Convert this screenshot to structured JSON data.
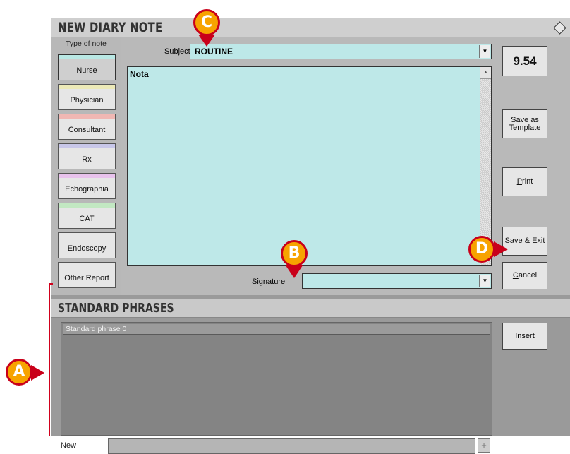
{
  "window": {
    "title": "NEW DIARY NOTE"
  },
  "note_types": {
    "header": "Type of note",
    "items": [
      {
        "label": "Nurse",
        "color": "#b9e8e4"
      },
      {
        "label": "Physician",
        "color": "#ece9b7"
      },
      {
        "label": "Consultant",
        "color": "#f0b7b3"
      },
      {
        "label": "Rx",
        "color": "#c8c7e9"
      },
      {
        "label": "Echographia",
        "color": "#e8c2ec"
      },
      {
        "label": "CAT",
        "color": "#c2e8c2"
      },
      {
        "label": "Endoscopy",
        "color": "#e6e6e6"
      },
      {
        "label": "Other Report",
        "color": "#e6e6e6"
      }
    ]
  },
  "subject": {
    "label": "Subject",
    "value": "ROUTINE"
  },
  "note": {
    "text": "Nota"
  },
  "signature": {
    "label": "Signature",
    "value": ""
  },
  "actions": {
    "clock": "9.54",
    "save_template": "Save as Template",
    "print": "Print",
    "save_exit": "Save & Exit",
    "cancel": "Cancel"
  },
  "standard_phrases": {
    "title": "STANDARD PHRASES",
    "items": [
      "Standard phrase 0"
    ],
    "insert": "Insert",
    "new_label": "New"
  },
  "callouts": {
    "a": "A",
    "b": "B",
    "c": "C",
    "d": "D"
  },
  "colors": {
    "field_bg": "#bde8e8",
    "callout_fill": "#f7a300",
    "callout_border": "#c9001a"
  }
}
